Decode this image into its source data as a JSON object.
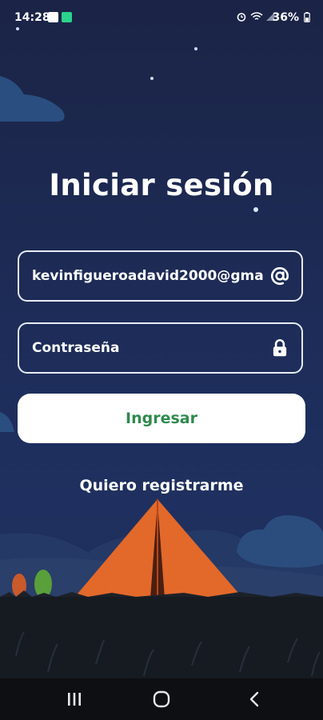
{
  "status_bar": {
    "time": "14:28",
    "battery": "36%"
  },
  "login": {
    "title": "Iniciar sesión",
    "email_value": "kevinfigueroadavid2000@gma",
    "password_placeholder": "Contraseña",
    "submit_label": "Ingresar",
    "register_label": "Quiero registrarme"
  },
  "colors": {
    "background": "#1d2c58",
    "accent_green": "#2e8a4e",
    "tent_orange": "#e2692a"
  }
}
